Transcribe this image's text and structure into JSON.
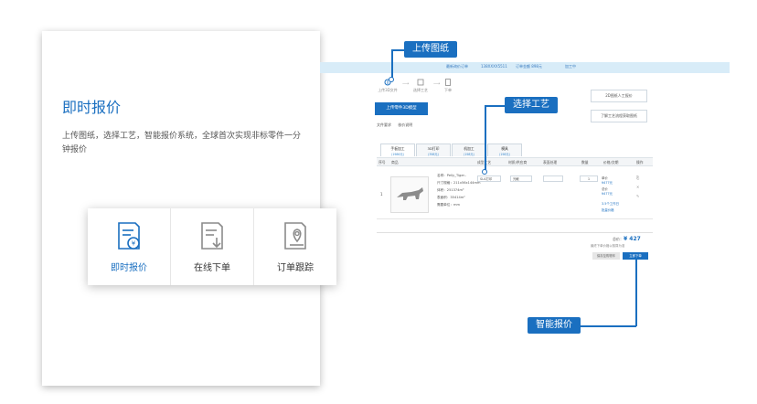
{
  "feature": {
    "title": "即时报价",
    "desc": "上传图纸，选择工艺，智能报价系统，全球首次实现非标零件一分钟报价"
  },
  "tabs": [
    {
      "label": "即时报价",
      "icon": "quote-document-icon",
      "active": true
    },
    {
      "label": "在线下单",
      "icon": "order-document-icon",
      "active": false
    },
    {
      "label": "订单跟踪",
      "icon": "location-document-icon",
      "active": false
    }
  ],
  "callouts": {
    "upload": "上传图纸",
    "process": "选择工艺",
    "pricing": "智能报价"
  },
  "screen": {
    "topbar": {
      "order": "最新询价订单",
      "phone": "138XXXX5511",
      "amount": "订单金额 898元",
      "status": "加工中"
    },
    "steps": [
      {
        "label": "上传3D文件"
      },
      {
        "label": "选择工艺"
      },
      {
        "label": "下单"
      }
    ],
    "upload_button": "上传零件3D模型",
    "file_links": [
      "文件要求",
      "核价说明"
    ],
    "side_buttons": [
      "2D图纸人工报价",
      "了解工艺流程获取图纸"
    ],
    "process_tabs": [
      {
        "name": "手板加工",
        "sub": "(1986元)"
      },
      {
        "name": "3D打印",
        "sub": "(398元)"
      },
      {
        "name": "机加工",
        "sub": "(198元)"
      },
      {
        "name": "模具",
        "sub": "(198元)"
      }
    ],
    "table_headers": [
      "序号",
      "商品",
      "成型工艺",
      "材质/供应商",
      "表面处理",
      "数量",
      "价格/交期",
      "操作"
    ],
    "row": {
      "index": "1",
      "specs": [
        "名称：Pelly_Tiger..",
        "尺寸规格：211x56x144mm",
        "体积：251374m³",
        "表面积：35414m²",
        "需要单位：mm"
      ],
      "process": "SLA打印",
      "material": "光敏",
      "quantity": "1",
      "price_lines": [
        "单价",
        "¥477元",
        "总价",
        "¥477元",
        "3.5个工作日",
        "批量价格"
      ],
      "ops": [
        "复制",
        "删除",
        "修改"
      ]
    },
    "total_label": "总价：",
    "total_value": "¥ 427",
    "total_note": "最终下单价格以核算为准",
    "btn_secondary": "保存至购物车",
    "btn_primary": "立即下单"
  }
}
